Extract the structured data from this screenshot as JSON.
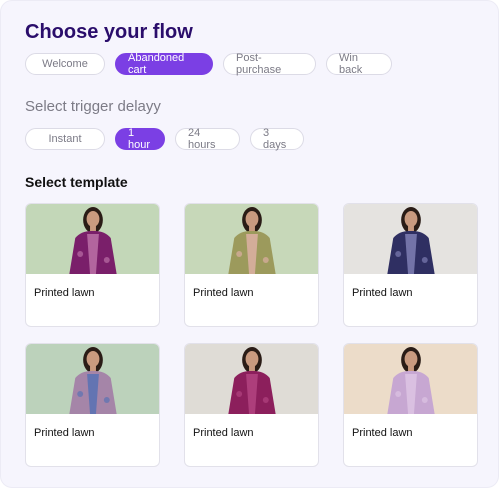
{
  "heading": "Choose your flow",
  "flows": [
    {
      "label": "Welcome",
      "active": false
    },
    {
      "label": "Abandoned cart",
      "active": true
    },
    {
      "label": "Post-purchase",
      "active": false
    },
    {
      "label": "Win back",
      "active": false
    }
  ],
  "delay_heading": "Select trigger delayy",
  "delays": [
    {
      "label": "Instant",
      "active": false
    },
    {
      "label": "1 hour",
      "active": true
    },
    {
      "label": "24 hours",
      "active": false
    },
    {
      "label": "3 days",
      "active": false
    }
  ],
  "template_heading": "Select template",
  "templates": [
    {
      "title": "Printed lawn",
      "bg": "#c3d7b8",
      "dress": "#7a1f6a",
      "accent": "#c57db0",
      "skin": "#c99a7f",
      "hair": "#2a1c16"
    },
    {
      "title": "Printed lawn",
      "bg": "#c7d8b9",
      "dress": "#9c9a5c",
      "accent": "#e6b3ad",
      "skin": "#c99a7f",
      "hair": "#2a1c16"
    },
    {
      "title": "Printed lawn",
      "bg": "#e5e3e0",
      "dress": "#2f2f62",
      "accent": "#8b8bc0",
      "skin": "#c99a7f",
      "hair": "#2a1c16"
    },
    {
      "title": "Printed lawn",
      "bg": "#bcd2bb",
      "dress": "#a585a8",
      "accent": "#4d6fb5",
      "skin": "#c99a7f",
      "hair": "#2a1c16"
    },
    {
      "title": "Printed lawn",
      "bg": "#dfdcd6",
      "dress": "#8c1f5c",
      "accent": "#b84a86",
      "skin": "#c99a7f",
      "hair": "#2a1c16"
    },
    {
      "title": "Printed lawn",
      "bg": "#ecdcc9",
      "dress": "#c7a7d2",
      "accent": "#e0c8e6",
      "skin": "#c99a7f",
      "hair": "#2a1c16"
    }
  ]
}
